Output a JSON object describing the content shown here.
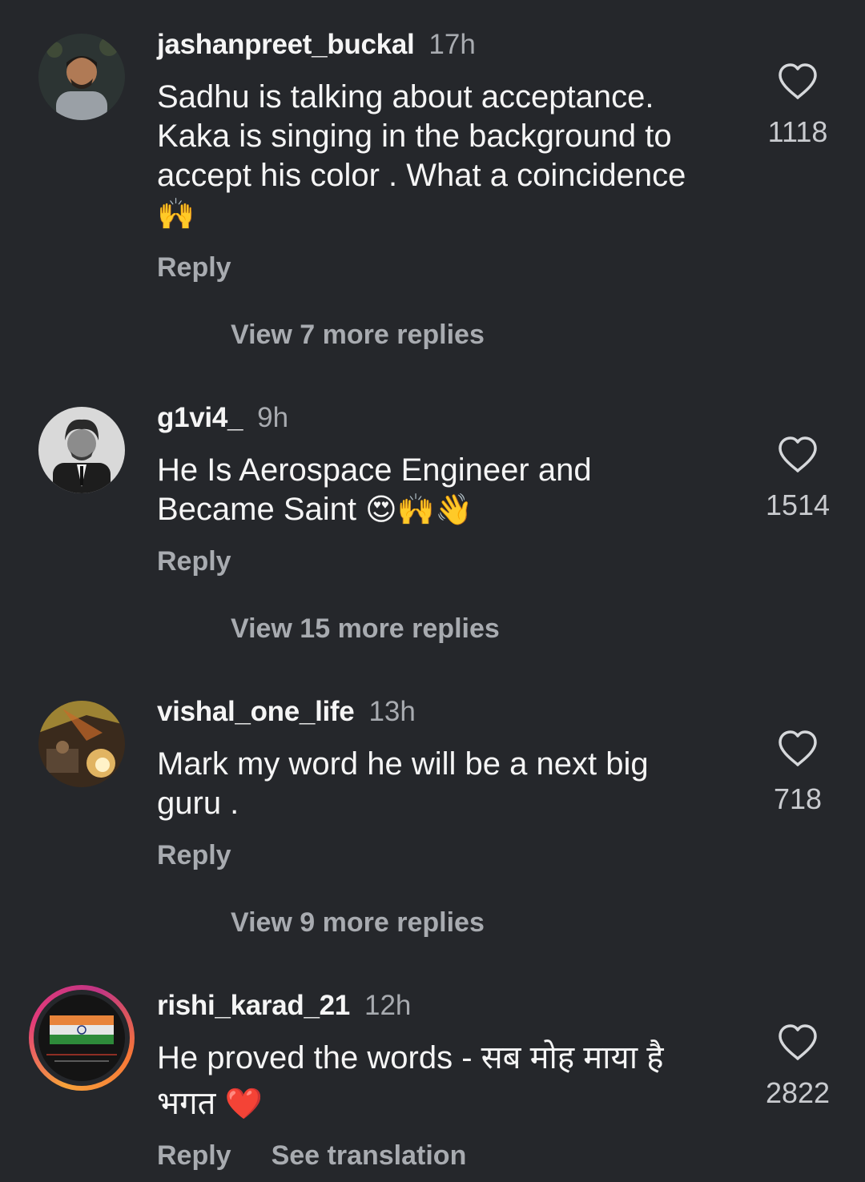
{
  "comments": [
    {
      "username": "jashanpreet_buckal",
      "time": "17h",
      "text_lines": [
        "Sadhu is talking about acceptance.",
        "Kaka is singing in the background to",
        "accept his color . What a coincidence"
      ],
      "emoji_line": "🙌",
      "likes": "1118",
      "reply_label": "Reply",
      "view_replies": "View 7 more replies"
    },
    {
      "username": "g1vi4_",
      "time": "9h",
      "text_lines": [
        "He Is Aerospace Engineer and",
        "Became Saint"
      ],
      "emoji_inline": "😍🙌👋",
      "likes": "1514",
      "reply_label": "Reply",
      "view_replies": "View 15 more replies"
    },
    {
      "username": "vishal_one_life",
      "time": "13h",
      "text_lines": [
        "Mark my word he will be a next big",
        "guru ."
      ],
      "likes": "718",
      "reply_label": "Reply",
      "view_replies": "View 9 more replies"
    },
    {
      "username": "rishi_karad_21",
      "time": "12h",
      "text_lines": [
        "He proved the words - सब मोह माया है",
        "भगत"
      ],
      "emoji_inline": "❤️",
      "likes": "2822",
      "reply_label": "Reply",
      "see_translation": "See translation"
    }
  ],
  "icons": {
    "like": "heart-outline-icon"
  },
  "colors": {
    "background": "#25272b",
    "text_primary": "#f5f5f5",
    "text_secondary": "#a8abb0",
    "story_ring": "#e23a7a"
  }
}
